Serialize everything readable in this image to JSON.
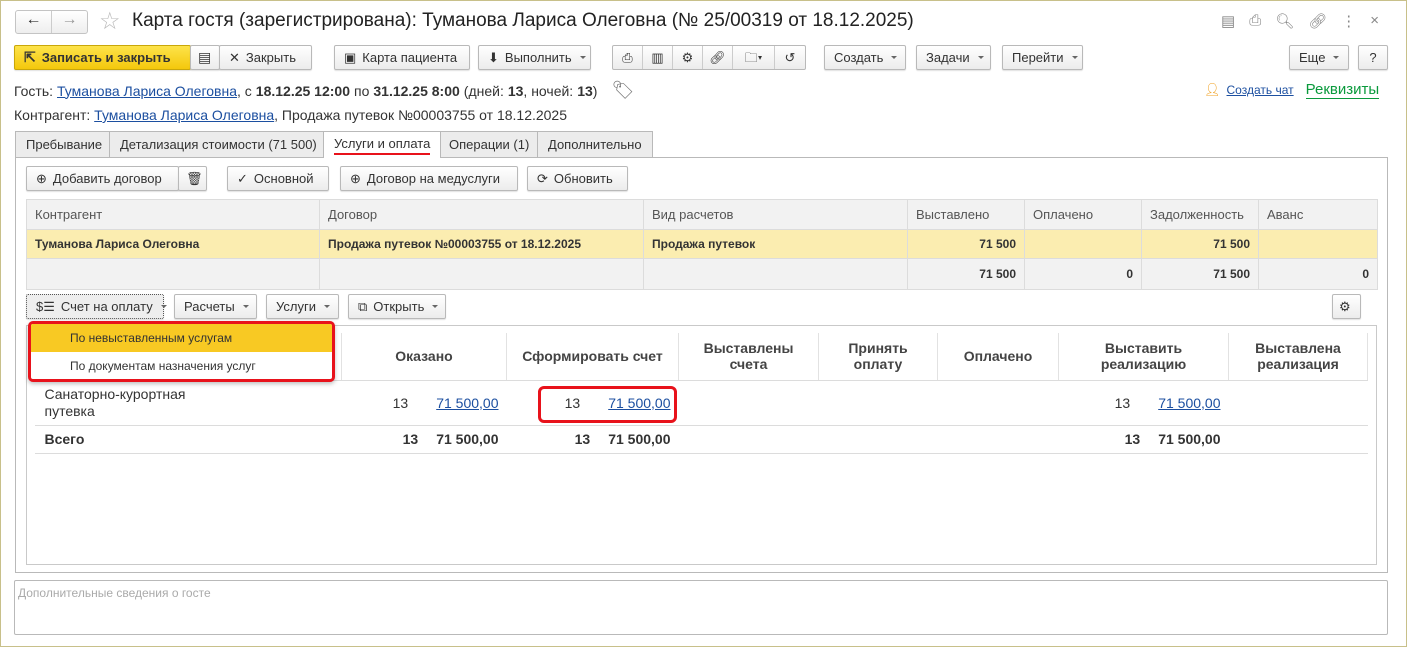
{
  "window": {
    "title": "Карта гостя (зарегистрирована): Туманова Лариса Олеговна (№ 25/00319 от 18.12.2025)"
  },
  "toolbar": {
    "save_close": "Записать и закрыть",
    "close": "Закрыть",
    "patient_card": "Карта пациента",
    "execute": "Выполнить",
    "create": "Создать",
    "tasks": "Задачи",
    "go": "Перейти",
    "more": "Еще",
    "help": "?"
  },
  "guest": {
    "label": "Гость:",
    "name": "Туманова Лариса Олеговна",
    "from_prefix": ", с",
    "from": "18.12.25 12:00",
    "to_prefix": "по",
    "to": "31.12.25 8:00",
    "days_prefix": "(дней:",
    "days": "13",
    "nights_prefix": ", ночей:",
    "nights": "13",
    "close_paren": ")"
  },
  "contractor": {
    "label": "Контрагент:",
    "name": "Туманова Лариса Олеговна",
    "rest": ", Продажа путевок №00003755 от 18.12.2025"
  },
  "links": {
    "chat": "Создать чат",
    "requisites": "Реквизиты"
  },
  "tabs": [
    "Пребывание",
    "Детализация стоимости (71 500)",
    "Услуги и оплата",
    "Операции (1)",
    "Дополнительно"
  ],
  "panel_buttons": {
    "add_contract": "Добавить договор",
    "main": "Основной",
    "med_contract": "Договор на медуслуги",
    "refresh": "Обновить"
  },
  "contracts_table": {
    "headers": [
      "Контрагент",
      "Договор",
      "Вид расчетов",
      "Выставлено",
      "Оплачено",
      "Задолженность",
      "Аванс"
    ],
    "row": [
      "Туманова Лариса Олеговна",
      "Продажа путевок №00003755 от 18.12.2025",
      "Продажа путевок",
      "71 500",
      "",
      "71 500",
      ""
    ],
    "totals": [
      "",
      "",
      "",
      "71 500",
      "0",
      "71 500",
      "0"
    ]
  },
  "sub_buttons": {
    "invoice": "Счет на оплату",
    "settlements": "Расчеты",
    "services": "Услуги",
    "open": "Открыть"
  },
  "dropdown": [
    "По невыставленным услугам",
    "По документам назначения услуг"
  ],
  "services_table": {
    "headers": [
      "",
      "Оказано",
      "Сформировать счет",
      "Выставлены счета",
      "Принять оплату",
      "Оплачено",
      "Выставить реализацию",
      "Выставлена реализация"
    ],
    "row": {
      "name": "Санаторно-курортная путевка",
      "provided_qty": "13",
      "provided_sum": "71 500,00",
      "form_qty": "13",
      "form_sum": "71 500,00",
      "realize_qty": "13",
      "realize_sum": "71 500,00"
    },
    "total": {
      "label": "Всего",
      "provided_qty": "13",
      "provided_sum": "71 500,00",
      "form_qty": "13",
      "form_sum": "71 500,00",
      "realize_qty": "13",
      "realize_sum": "71 500,00"
    }
  },
  "notes": {
    "placeholder": "Дополнительные сведения о госте"
  }
}
